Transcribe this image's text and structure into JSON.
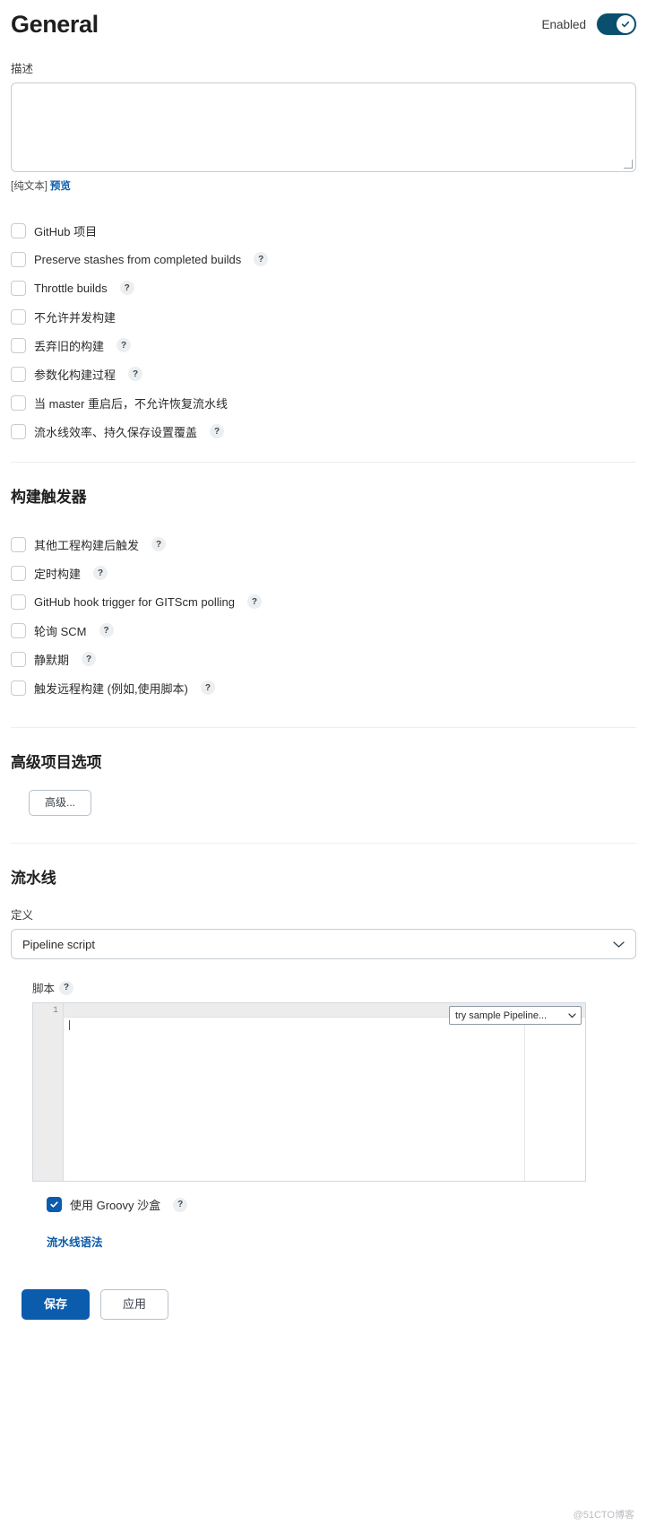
{
  "header": {
    "title": "General",
    "enabled_label": "Enabled",
    "toggle_state": "on",
    "toggle_color": "#0b4f6e"
  },
  "description": {
    "label": "描述",
    "value": "",
    "plain_text_note": "[纯文本]",
    "preview_link": "预览"
  },
  "general_options": [
    {
      "label": "GitHub 项目",
      "checked": false,
      "help": false
    },
    {
      "label": "Preserve stashes from completed builds",
      "checked": false,
      "help": true
    },
    {
      "label": "Throttle builds",
      "checked": false,
      "help": true
    },
    {
      "label": "不允许并发构建",
      "checked": false,
      "help": false
    },
    {
      "label": "丢弃旧的构建",
      "checked": false,
      "help": true
    },
    {
      "label": "参数化构建过程",
      "checked": false,
      "help": true
    },
    {
      "label": "当 master 重启后，不允许恢复流水线",
      "checked": false,
      "help": false
    },
    {
      "label": "流水线效率、持久保存设置覆盖",
      "checked": false,
      "help": true
    }
  ],
  "build_triggers": {
    "title": "构建触发器",
    "options": [
      {
        "label": "其他工程构建后触发",
        "checked": false,
        "help": true
      },
      {
        "label": "定时构建",
        "checked": false,
        "help": true
      },
      {
        "label": "GitHub hook trigger for GITScm polling",
        "checked": false,
        "help": true
      },
      {
        "label": "轮询 SCM",
        "checked": false,
        "help": true
      },
      {
        "label": "静默期",
        "checked": false,
        "help": true
      },
      {
        "label": "触发远程构建 (例如,使用脚本)",
        "checked": false,
        "help": true
      }
    ]
  },
  "advanced_options": {
    "title": "高级项目选项",
    "button_label": "高级..."
  },
  "pipeline": {
    "title": "流水线",
    "definition_label": "定义",
    "definition_value": "Pipeline script",
    "script_label": "脚本",
    "script_help": "?",
    "line_number": "1",
    "script_value": "",
    "sample_select_value": "try sample Pipeline...",
    "sandbox_label": "使用 Groovy 沙盒",
    "sandbox_checked": true,
    "syntax_link": "流水线语法"
  },
  "footer": {
    "save_label": "保存",
    "apply_label": "应用"
  },
  "watermark": "@51CTO博客",
  "icons": {
    "help": "?",
    "check": "check-icon",
    "chevron": "chevron-down-icon"
  }
}
